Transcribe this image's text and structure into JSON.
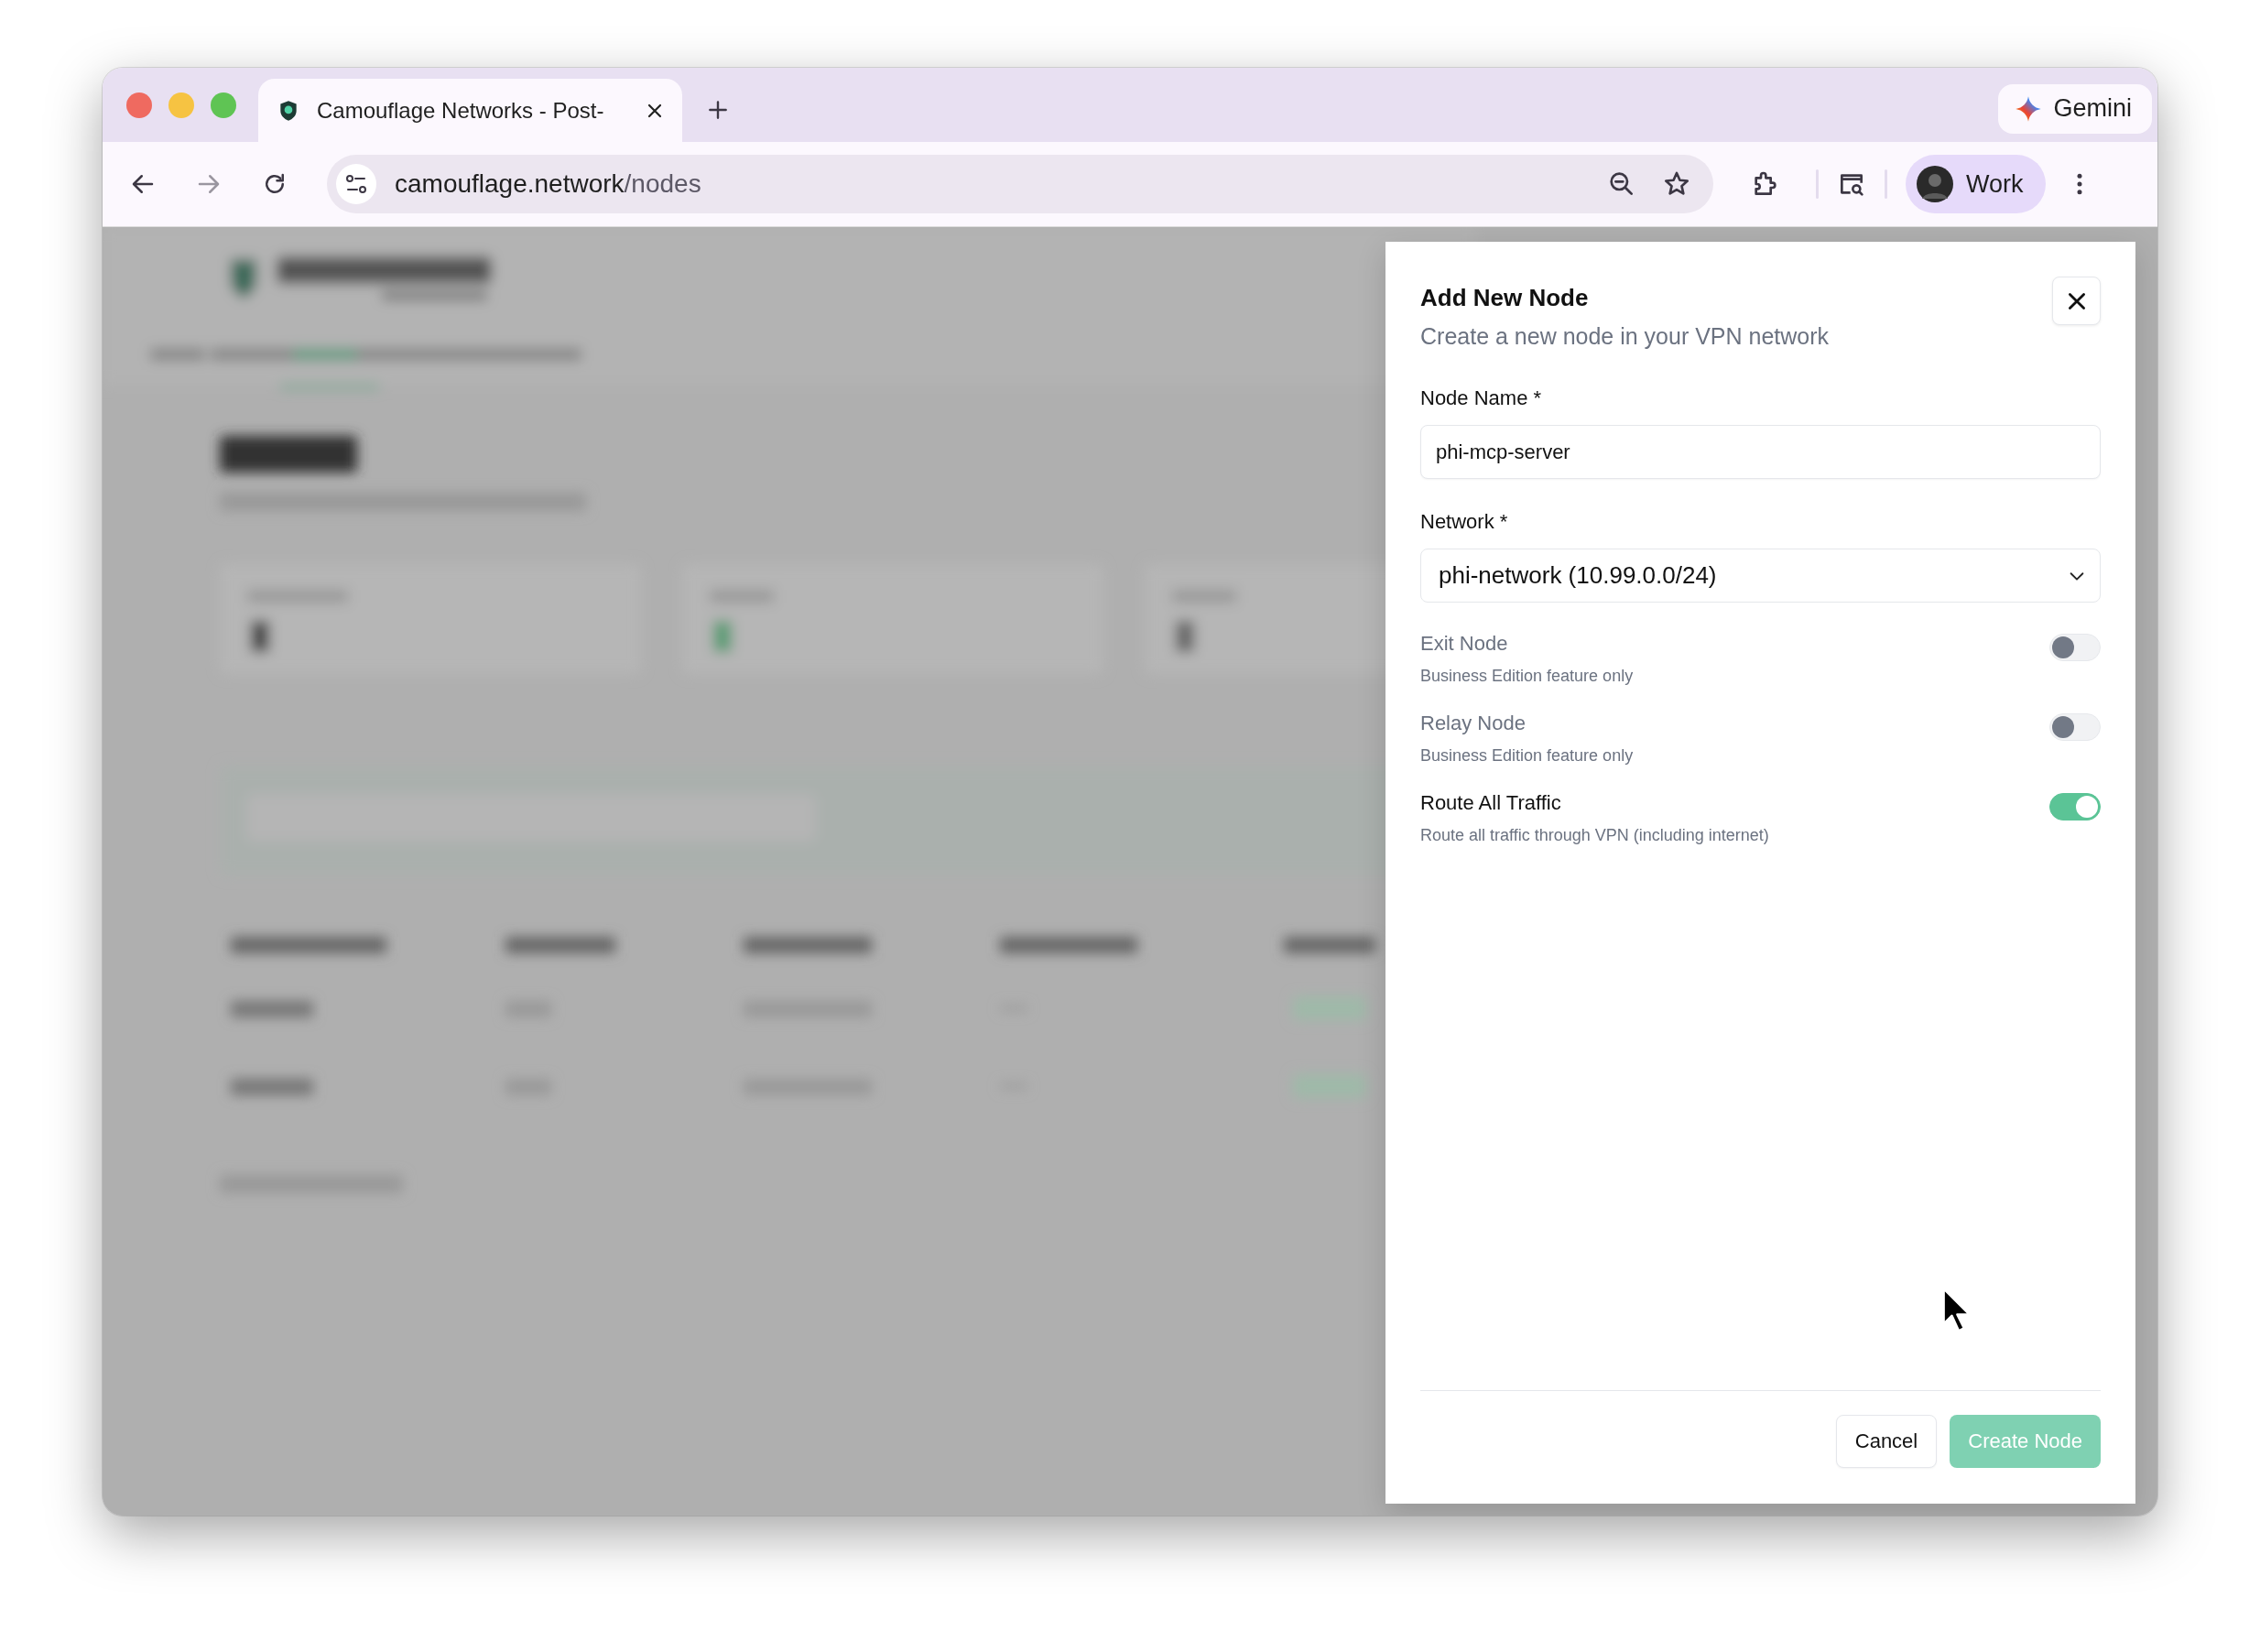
{
  "browser": {
    "tabs": [
      {
        "title": "Camouflage Networks - Post-",
        "selected": true
      }
    ],
    "url": {
      "host": "camouflage.network",
      "path": "/nodes"
    },
    "gemini": "Gemini",
    "profile": "Work"
  },
  "modal": {
    "title": "Add New Node",
    "subtitle": "Create a new node in your VPN network",
    "fields": [
      {
        "kind": "text",
        "label": "Node Name *",
        "value": "phi-mcp-server"
      },
      {
        "kind": "select",
        "label": "Network *",
        "value": "phi-network (10.99.0.0/24)"
      }
    ],
    "toggles": [
      {
        "label": "Exit Node",
        "description": "Business Edition feature only",
        "on": false,
        "disabled": true
      },
      {
        "label": "Relay Node",
        "description": "Business Edition feature only",
        "on": false,
        "disabled": true
      },
      {
        "label": "Route All Traffic",
        "description": "Route all traffic through VPN (including internet)",
        "on": true,
        "disabled": false
      }
    ],
    "buttons": [
      {
        "kind": "secondary",
        "label": "Cancel",
        "disabled": false
      },
      {
        "kind": "primary",
        "label": "Create Node",
        "disabled": true
      }
    ]
  }
}
